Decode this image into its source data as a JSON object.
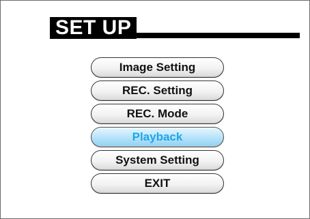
{
  "screen": {
    "title": "SET UP"
  },
  "menu": {
    "items": [
      {
        "label": "Image Setting",
        "selected": false
      },
      {
        "label": "REC. Setting",
        "selected": false
      },
      {
        "label": "REC. Mode",
        "selected": false
      },
      {
        "label": "Playback",
        "selected": true
      },
      {
        "label": "System Setting",
        "selected": false
      },
      {
        "label": "EXIT",
        "selected": false
      }
    ]
  },
  "colors": {
    "title_background": "#000000",
    "title_text": "#ffffff",
    "selected_text": "#1ea6e6",
    "selected_fill": "#b9e4fb"
  }
}
